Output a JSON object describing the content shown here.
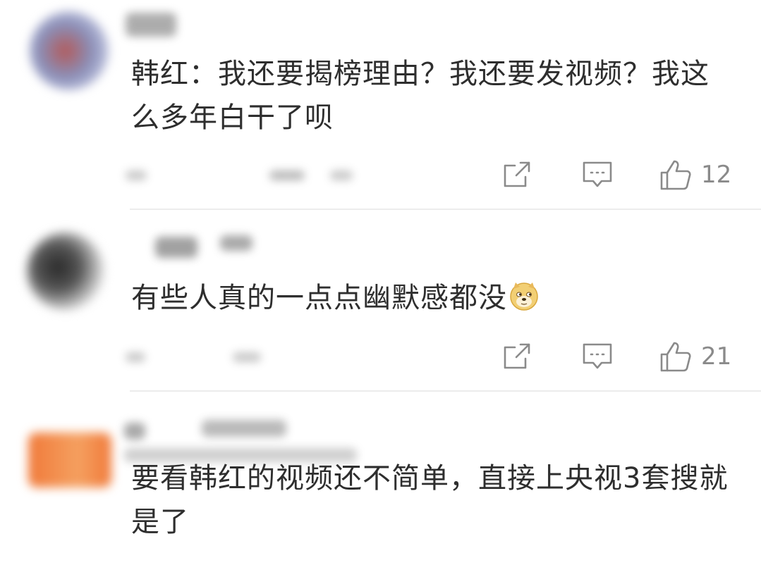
{
  "comments": [
    {
      "text": "韩红：我还要揭榜理由？我还要发视频？我这么多年白干了呗",
      "like_count": "12",
      "avatar_color": "#8a8fb8"
    },
    {
      "text": "有些人真的一点点幽默感都没",
      "emoji": "doge-emoji",
      "like_count": "21",
      "avatar_color": "#555555"
    },
    {
      "text": "要看韩红的视频还不简单，直接上央视3套搜就是了",
      "avatar_color": "#f07a3a"
    }
  ],
  "icons": {
    "share": "share-icon",
    "reply": "comment-icon",
    "like": "thumbs-up-icon"
  },
  "colors": {
    "icon_gray": "#8a8a8a",
    "text": "#2e2e2e",
    "divider": "#ececec"
  }
}
